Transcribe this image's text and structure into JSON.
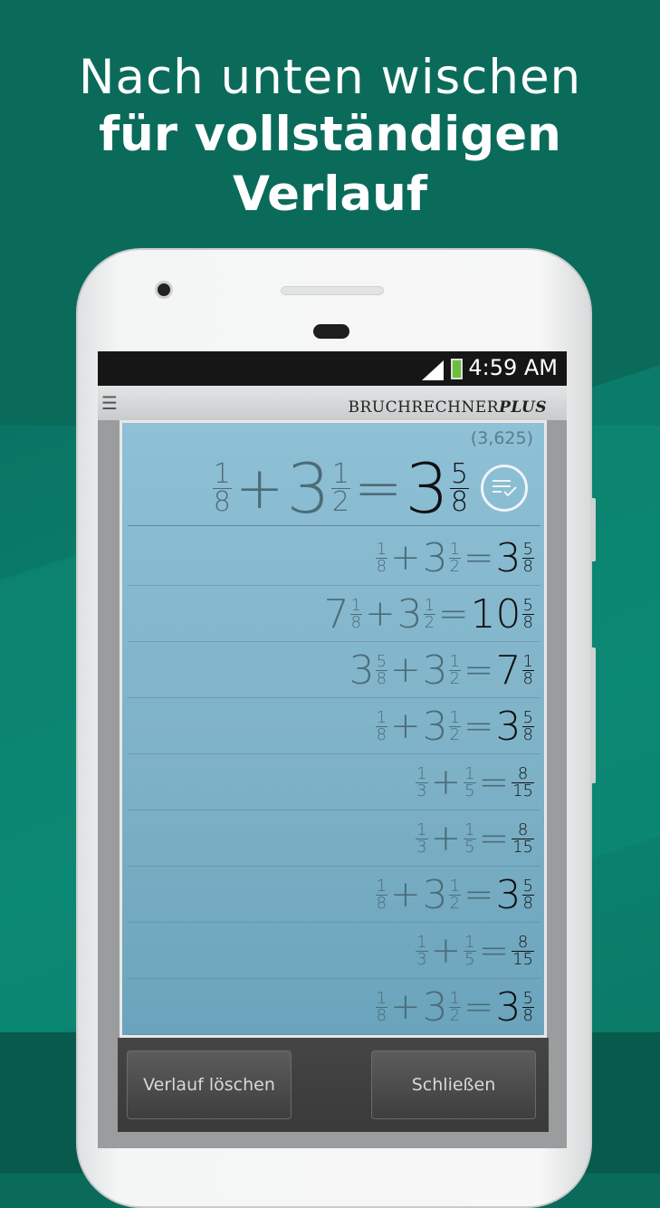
{
  "headline": {
    "line1": "Nach unten wischen",
    "line2": "für vollständigen Verlauf"
  },
  "status_bar": {
    "time": "4:59 AM",
    "icons": [
      "signal-icon",
      "battery-charging-icon"
    ]
  },
  "app": {
    "brand_main": "BRUCHRECHNER",
    "brand_plus": "PLUS",
    "menu_icon": "hamburger-menu-icon"
  },
  "display": {
    "decimal": "(3,625)",
    "expression": {
      "a": {
        "whole": "",
        "num": "1",
        "den": "8"
      },
      "op": "+",
      "b": {
        "whole": "3",
        "num": "1",
        "den": "2"
      },
      "eq": "=",
      "r": {
        "whole": "3",
        "num": "5",
        "den": "8"
      }
    },
    "history_icon": "history-list-check-icon"
  },
  "history": [
    {
      "a": {
        "whole": "",
        "num": "1",
        "den": "8"
      },
      "op": "+",
      "b": {
        "whole": "3",
        "num": "1",
        "den": "2"
      },
      "eq": "=",
      "r": {
        "whole": "3",
        "num": "5",
        "den": "8"
      }
    },
    {
      "a": {
        "whole": "7",
        "num": "1",
        "den": "8"
      },
      "op": "+",
      "b": {
        "whole": "3",
        "num": "1",
        "den": "2"
      },
      "eq": "=",
      "r": {
        "whole": "10",
        "num": "5",
        "den": "8"
      }
    },
    {
      "a": {
        "whole": "3",
        "num": "5",
        "den": "8"
      },
      "op": "+",
      "b": {
        "whole": "3",
        "num": "1",
        "den": "2"
      },
      "eq": "=",
      "r": {
        "whole": "7",
        "num": "1",
        "den": "8"
      }
    },
    {
      "a": {
        "whole": "",
        "num": "1",
        "den": "8"
      },
      "op": "+",
      "b": {
        "whole": "3",
        "num": "1",
        "den": "2"
      },
      "eq": "=",
      "r": {
        "whole": "3",
        "num": "5",
        "den": "8"
      }
    },
    {
      "a": {
        "whole": "",
        "num": "1",
        "den": "3"
      },
      "op": "+",
      "b": {
        "whole": "",
        "num": "1",
        "den": "5"
      },
      "eq": "=",
      "r": {
        "whole": "",
        "num": "8",
        "den": "15"
      }
    },
    {
      "a": {
        "whole": "",
        "num": "1",
        "den": "3"
      },
      "op": "+",
      "b": {
        "whole": "",
        "num": "1",
        "den": "5"
      },
      "eq": "=",
      "r": {
        "whole": "",
        "num": "8",
        "den": "15"
      }
    },
    {
      "a": {
        "whole": "",
        "num": "1",
        "den": "8"
      },
      "op": "+",
      "b": {
        "whole": "3",
        "num": "1",
        "den": "2"
      },
      "eq": "=",
      "r": {
        "whole": "3",
        "num": "5",
        "den": "8"
      }
    },
    {
      "a": {
        "whole": "",
        "num": "1",
        "den": "3"
      },
      "op": "+",
      "b": {
        "whole": "",
        "num": "1",
        "den": "5"
      },
      "eq": "=",
      "r": {
        "whole": "",
        "num": "8",
        "den": "15"
      }
    },
    {
      "a": {
        "whole": "",
        "num": "1",
        "den": "8"
      },
      "op": "+",
      "b": {
        "whole": "3",
        "num": "1",
        "den": "2"
      },
      "eq": "=",
      "r": {
        "whole": "3",
        "num": "5",
        "den": "8"
      }
    }
  ],
  "buttons": {
    "clear_label": "Verlauf löschen",
    "close_label": "Schließen"
  },
  "colors": {
    "background": "#0b6b5b",
    "panel": "#8ec0d6",
    "result_text": "#111111",
    "operand_text": "#4d6b78"
  }
}
